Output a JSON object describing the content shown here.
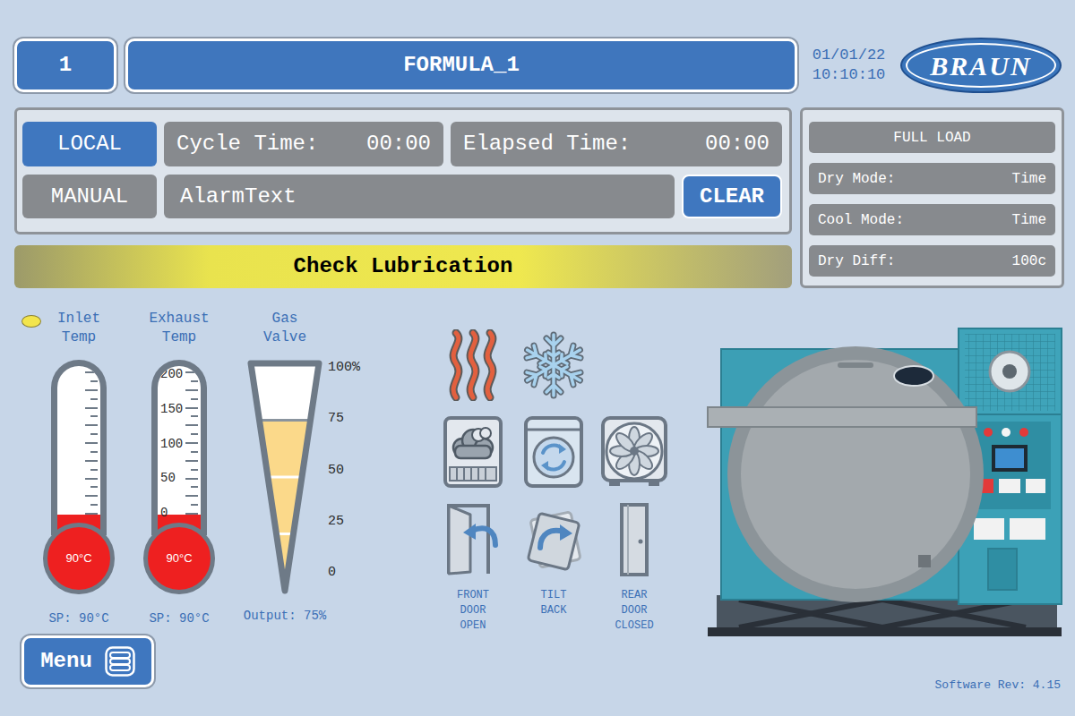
{
  "header": {
    "formula_number": "1",
    "formula_name": "FORMULA_1",
    "date": "01/01/22",
    "time": "10:10:10",
    "logo": "BRAUN"
  },
  "controls": {
    "modes": [
      {
        "label": "LOCAL",
        "active": true
      },
      {
        "label": "MANUAL",
        "active": false
      }
    ],
    "cycle_time": {
      "label": "Cycle Time:",
      "value": "00:00"
    },
    "elapsed_time": {
      "label": "Elapsed Time:",
      "value": "00:00"
    },
    "alarm_text": "AlarmText",
    "clear_button": "CLEAR"
  },
  "banner": "Check Lubrication",
  "load_panel": {
    "title": "FULL LOAD",
    "rows": [
      {
        "label": "Dry Mode:",
        "value": "Time"
      },
      {
        "label": "Cool Mode:",
        "value": "Time"
      },
      {
        "label": "Dry Diff:",
        "value": "100c"
      }
    ]
  },
  "thermometers": [
    {
      "label": "Inlet Temp",
      "indicator": true,
      "scale": [],
      "level": 0.12,
      "reading": "90°C",
      "setpoint": "SP: 90°C"
    },
    {
      "label": "Exhaust Temp",
      "indicator": false,
      "scale": [
        "200",
        "150",
        "100",
        "50",
        "0"
      ],
      "level": 0.12,
      "reading": "90°C",
      "setpoint": "SP: 90°C"
    }
  ],
  "gas_valve": {
    "label": "Gas Valve",
    "scale": [
      "100%",
      "75",
      "50",
      "25",
      "0"
    ],
    "level": 0.75,
    "output": "Output: 75%"
  },
  "door_status": [
    "FRONT DOOR OPEN",
    "TILT BACK",
    "REAR DOOR CLOSED"
  ],
  "menu_button": "Menu",
  "software_rev": "Software Rev: 4.15"
}
